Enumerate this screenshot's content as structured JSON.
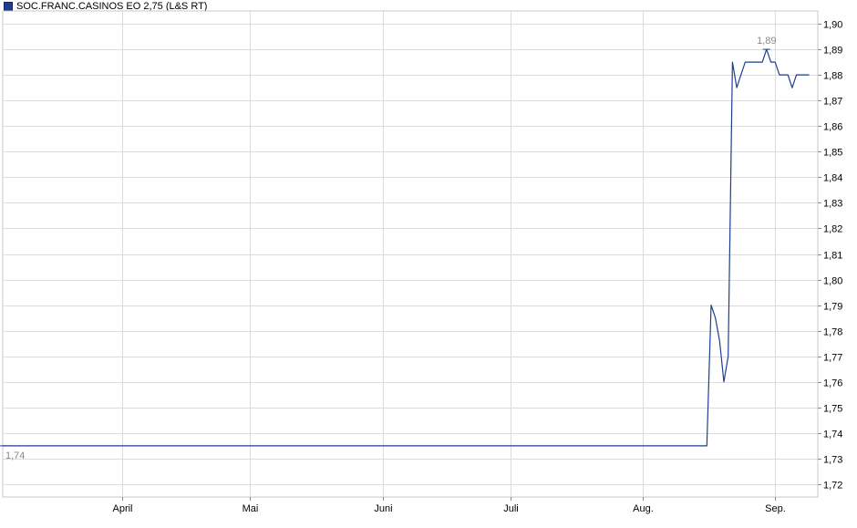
{
  "chart_data": {
    "type": "line",
    "legend": "SOC.FRANC.CASINOS EO 2,75 (L&S RT)",
    "x_ticks": [
      "April",
      "Mai",
      "Juni",
      "Juli",
      "Aug.",
      "Sep."
    ],
    "y_ticks": [
      "1,90",
      "1,89",
      "1,88",
      "1,87",
      "1,86",
      "1,85",
      "1,84",
      "1,83",
      "1,82",
      "1,81",
      "1,80",
      "1,79",
      "1,78",
      "1,77",
      "1,76",
      "1,75",
      "1,74",
      "1,73",
      "1,72"
    ],
    "ylim": [
      1.715,
      1.905
    ],
    "grid": true,
    "series": [
      {
        "color": "#1e3f8f",
        "x": [
          "2025-03-04",
          "2025-03-15",
          "2025-04-01",
          "2025-05-01",
          "2025-06-01",
          "2025-07-01",
          "2025-08-01",
          "2025-08-16",
          "2025-08-17",
          "2025-08-18",
          "2025-08-19",
          "2025-08-20",
          "2025-08-21",
          "2025-08-22",
          "2025-08-23",
          "2025-08-24",
          "2025-08-25",
          "2025-08-26",
          "2025-08-27",
          "2025-08-28",
          "2025-08-29",
          "2025-08-30",
          "2025-08-31",
          "2025-09-01",
          "2025-09-02",
          "2025-09-03",
          "2025-09-04",
          "2025-09-05",
          "2025-09-06",
          "2025-09-07",
          "2025-09-08",
          "2025-09-09"
        ],
        "values": [
          1.735,
          1.735,
          1.735,
          1.735,
          1.735,
          1.735,
          1.735,
          1.735,
          1.79,
          1.785,
          1.776,
          1.76,
          1.77,
          1.885,
          1.875,
          1.88,
          1.885,
          1.885,
          1.885,
          1.885,
          1.885,
          1.89,
          1.885,
          1.885,
          1.88,
          1.88,
          1.88,
          1.875,
          1.88,
          1.88,
          1.88,
          1.88
        ]
      }
    ],
    "annotations": [
      {
        "label": "1,74",
        "x": "2025-03-04",
        "y": 1.735
      },
      {
        "label": "1,89",
        "x": "2025-08-30",
        "y": 1.89
      }
    ]
  }
}
